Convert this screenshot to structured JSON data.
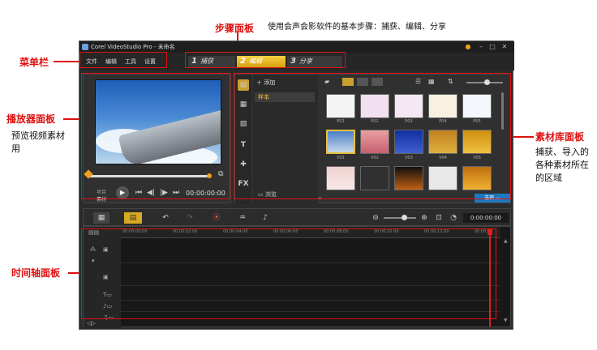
{
  "annotations": {
    "step_panel": "步骤面板",
    "step_desc": "使用会声会影软件的基本步骤：捕获、编辑、分享",
    "menu_bar": "菜单栏",
    "player_panel": "播放器面板",
    "player_desc": "预览视频素材用",
    "library_panel": "素材库面板",
    "library_desc": "捕获、导入的各种素材所在的区域",
    "timeline_panel": "时间轴面板"
  },
  "app": {
    "title": "Corel VideoStudio Pro - 未命名",
    "menu": [
      "文件",
      "编辑",
      "工具",
      "设置"
    ],
    "steps": [
      {
        "num": "1",
        "label": "捕获"
      },
      {
        "num": "2",
        "label": "编辑"
      },
      {
        "num": "3",
        "label": "分享"
      }
    ],
    "player": {
      "mode_project": "项目",
      "mode_clip": "素材",
      "timecode": "00:00:00:00"
    },
    "library": {
      "add_label": "添加",
      "folder_label": "样本",
      "browse_label": "浏览",
      "options_label": "选项",
      "thumbs_row1": [
        "P01",
        "P02",
        "P03",
        "P04",
        "P05"
      ],
      "thumbs_row2": [
        "V01",
        "V02",
        "V03",
        "V04",
        "V05"
      ]
    },
    "timeline": {
      "timecode": "0:00:00:00",
      "ruler": [
        "00:00:00:00",
        "00:00:02:00",
        "00:00:04:00",
        "00:00:06:00",
        "00:00:08:00",
        "00:00:10:00",
        "00:00:12:00",
        "00:00:14"
      ]
    }
  }
}
